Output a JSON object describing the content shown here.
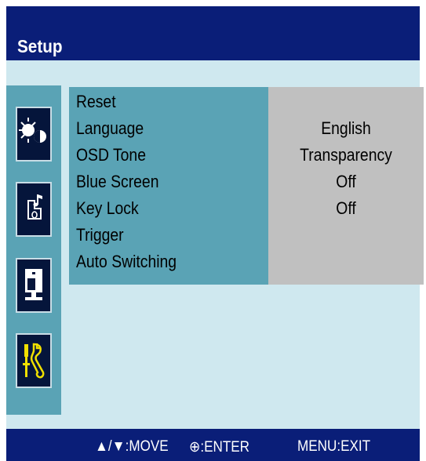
{
  "header": {
    "title": "Setup"
  },
  "sidebar": {
    "icons": [
      {
        "name": "picture-icon"
      },
      {
        "name": "audio-icon"
      },
      {
        "name": "input-icon"
      },
      {
        "name": "setup-tools-icon",
        "selected": true
      }
    ]
  },
  "menu": {
    "items": [
      {
        "label": "Reset",
        "value": ""
      },
      {
        "label": "Language",
        "value": "English"
      },
      {
        "label": "OSD Tone",
        "value": "Transparency"
      },
      {
        "label": "Blue Screen",
        "value": "Off"
      },
      {
        "label": "Key Lock",
        "value": "Off"
      },
      {
        "label": "Trigger",
        "value": ""
      },
      {
        "label": "Auto Switching",
        "value": ""
      }
    ]
  },
  "footer": {
    "move": "▲/▼:MOVE",
    "enter": "⊕:ENTER",
    "exit": "MENU:EXIT"
  },
  "colors": {
    "header_bg": "#0a1e78",
    "body_bg": "#cfe8ef",
    "menu_bg": "#5aa3b5",
    "value_bg": "#c0c0c0",
    "icon_bg": "#05153b",
    "selected_icon": "#f0e000"
  }
}
